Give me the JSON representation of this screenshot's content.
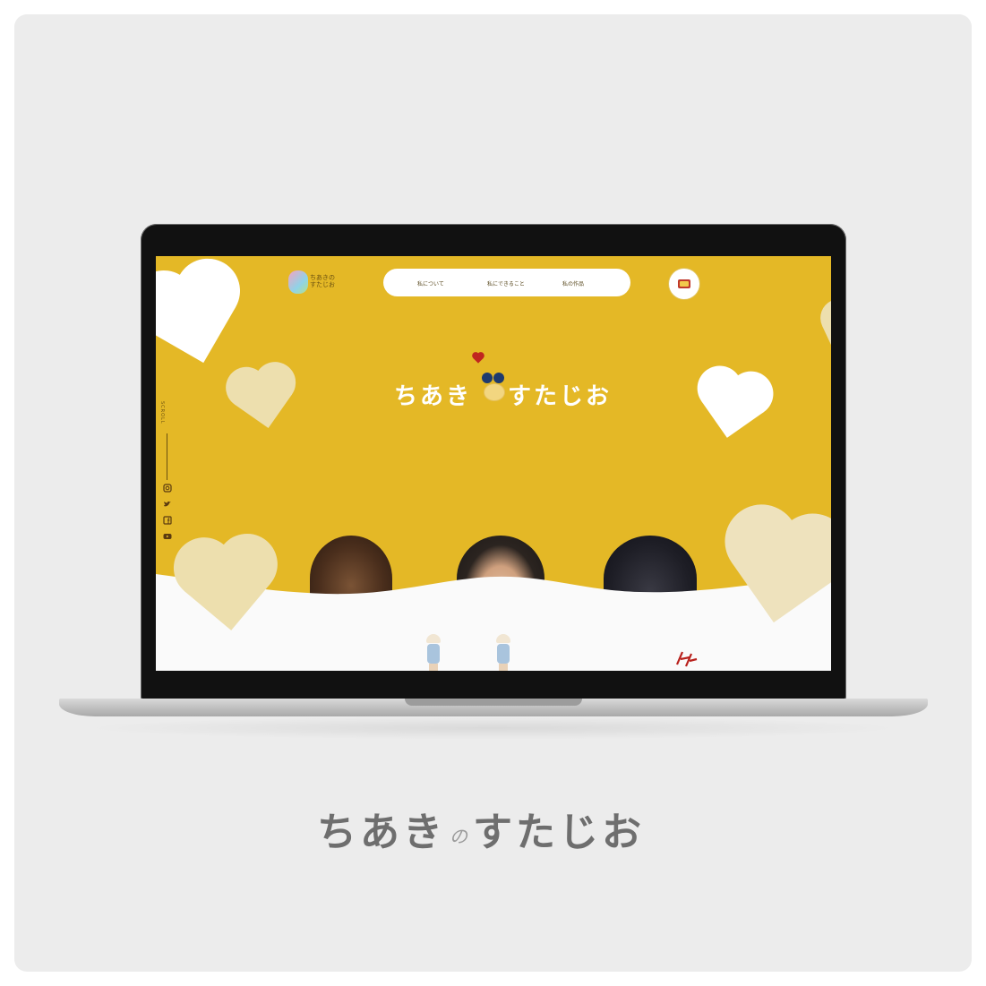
{
  "site": {
    "logo_text_line1": "ちあきの",
    "logo_text_line2": "すたじお",
    "nav": [
      "私について",
      "私にできること",
      "私の作品"
    ],
    "mail_button": "mail-icon",
    "hero_title_left": "ちあき",
    "hero_title_right": "すたじお",
    "scroll_label": "SCROLL",
    "social": [
      "instagram-icon",
      "twitter-icon",
      "facebook-icon",
      "youtube-icon"
    ]
  },
  "caption": {
    "left": "ちあき",
    "particle": "の",
    "right": "すたじお"
  },
  "colors": {
    "brand_yellow": "#e4b826",
    "heart_white": "#ffffff",
    "heart_pale": "#eddfae",
    "caption_gray": "#6e6e6e"
  }
}
